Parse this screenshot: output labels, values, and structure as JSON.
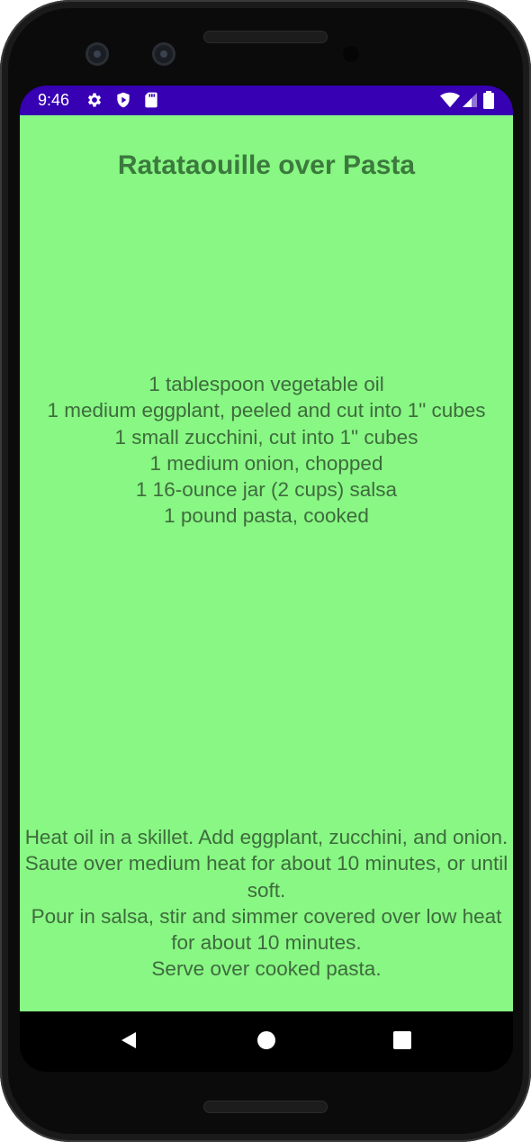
{
  "status_bar": {
    "time": "9:46",
    "left_icons": [
      "gear-icon",
      "shield-icon",
      "sd-card-icon"
    ],
    "right_icons": [
      "wifi-icon",
      "cell-signal-icon",
      "battery-icon"
    ],
    "background": "#3700b3"
  },
  "recipe": {
    "title": "Ratataouille over Pasta",
    "ingredients": [
      "1 tablespoon vegetable oil",
      "1 medium eggplant, peeled and cut into 1\" cubes",
      "1 small zucchini, cut into 1\" cubes",
      "1 medium onion, chopped",
      "1 16-ounce jar (2 cups) salsa",
      "1 pound pasta, cooked"
    ],
    "directions": [
      "Heat oil in a skillet. Add eggplant, zucchini, and onion. Saute over medium heat for about 10 minutes, or until soft.",
      "Pour in salsa, stir and simmer covered over low heat for about 10 minutes.",
      "Serve over cooked pasta."
    ],
    "background": "#88f783",
    "text_color": "#3e6b3e"
  },
  "nav_bar": {
    "buttons": [
      "back-icon",
      "home-icon",
      "recents-icon"
    ]
  }
}
